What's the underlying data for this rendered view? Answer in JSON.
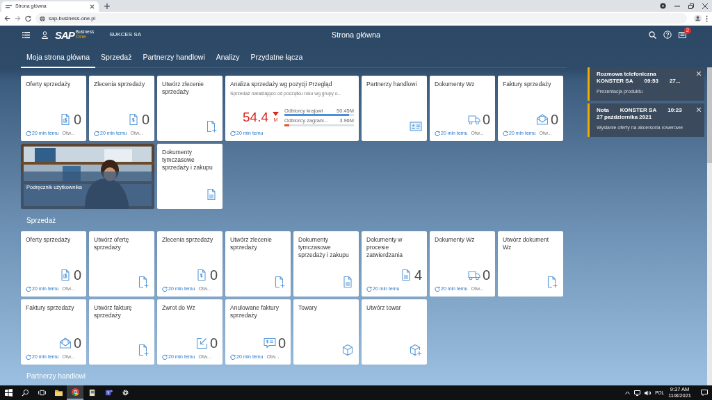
{
  "browser": {
    "tab_title": "Strona główna",
    "url": "sap-business-one.pl"
  },
  "header": {
    "logo": "SAP",
    "logo_sup": "Business",
    "logo_sub": "One",
    "company": "SUKCES SA",
    "title": "Strona główna",
    "notification_count": "2"
  },
  "tabs": [
    {
      "label": "Moja strona główna",
      "selected": true
    },
    {
      "label": "Sprzedaż",
      "selected": false
    },
    {
      "label": "Partnerzy handlowi",
      "selected": false
    },
    {
      "label": "Analizy",
      "selected": false
    },
    {
      "label": "Przydatne łącza",
      "selected": false
    }
  ],
  "groups": [
    {
      "tiles": [
        {
          "kind": "counter",
          "title": "Oferty sprzedaży",
          "count": "0",
          "refreshed": "20 min temu",
          "status": "Otw..."
        },
        {
          "kind": "counter",
          "title": "Zlecenia sprzedaży",
          "count": "0",
          "refreshed": "20 min temu",
          "status": "Otw..."
        },
        {
          "kind": "launch",
          "title": "Utwórz zlecenie sprzedaży"
        },
        {
          "kind": "analytic",
          "title": "Analiza sprzedaży wg pozycji Przegląd",
          "subtitle": "Sprzedaż narastająco od początku roku wg grupy o...",
          "value": "54.4",
          "unit": "M",
          "trend_down": true,
          "refreshed": "20 min temu",
          "bars": [
            {
              "label": "Odbiorcy krajowi",
              "reading": "50.45M",
              "level": 0.93,
              "color": "#4a8fdb"
            },
            {
              "label": "Odbiorcy zagrani...",
              "reading": "3.96M",
              "level": 0.07,
              "color": "#e8542a"
            }
          ]
        },
        {
          "kind": "launch",
          "title": "Partnerzy handlowi"
        },
        {
          "kind": "counter",
          "title": "Dokumenty Wz",
          "count": "0",
          "refreshed": "20 min temu",
          "status": "Otw..."
        },
        {
          "kind": "counter",
          "title": "Faktury sprzedaży",
          "count": "0",
          "refreshed": "20 min temu",
          "status": "Otw..."
        },
        {
          "kind": "picture",
          "title": "Podręcznik użytkownika"
        },
        {
          "kind": "launch",
          "title": "Dokumenty tymczasowe sprzedaży i zakupu"
        }
      ]
    },
    {
      "title": "Sprzedaż",
      "tiles": [
        {
          "kind": "counter",
          "title": "Oferty sprzedaży",
          "count": "0",
          "refreshed": "20 min temu",
          "status": "Otw..."
        },
        {
          "kind": "launch",
          "title": "Utwórz ofertę sprzedaży"
        },
        {
          "kind": "counter",
          "title": "Zlecenia sprzedaży",
          "count": "0",
          "refreshed": "20 min temu",
          "status": "Otw..."
        },
        {
          "kind": "launch",
          "title": "Utwórz zlecenie sprzedaży"
        },
        {
          "kind": "launch",
          "title": "Dokumenty tymczasowe sprzedaży i zakupu"
        },
        {
          "kind": "counter",
          "title": "Dokumenty w procesie zatwierdzania",
          "count": "4",
          "refreshed": "20 min temu"
        },
        {
          "kind": "counter",
          "title": "Dokumenty Wz",
          "count": "0",
          "refreshed": "20 min temu",
          "status": "Otw..."
        },
        {
          "kind": "launch",
          "title": "Utwórz dokument Wz"
        },
        {
          "kind": "counter",
          "title": "Faktury sprzedaży",
          "count": "0",
          "refreshed": "20 min temu",
          "status": "Otw..."
        },
        {
          "kind": "launch",
          "title": "Utwórz fakturę sprzedaży"
        },
        {
          "kind": "counter",
          "title": "Zwrot do Wz",
          "count": "0",
          "refreshed": "20 min temu",
          "status": "Otw..."
        },
        {
          "kind": "counter",
          "title": "Anulowane faktury sprzedaży",
          "count": "0",
          "refreshed": "20 min temu",
          "status": "Otw..."
        },
        {
          "kind": "launch",
          "title": "Towary"
        },
        {
          "kind": "launch",
          "title": "Utwórz towar"
        }
      ]
    },
    {
      "title": "Partnerzy handlowi"
    }
  ],
  "notifications": [
    {
      "title": "Rozmowa telefoniczna",
      "company": "KONSTER SA",
      "time": "09:53",
      "date": "27...",
      "description": "Prezentacja produktu"
    },
    {
      "title": "Nota",
      "company": "KONSTER SA",
      "time": "10:23",
      "date": "27 października 2021",
      "description": "Wysłanie oferty na akcersoria rowerowe"
    }
  ],
  "taskbar": {
    "language": "POL",
    "time": "9:37 AM",
    "date": "11/8/2021"
  }
}
